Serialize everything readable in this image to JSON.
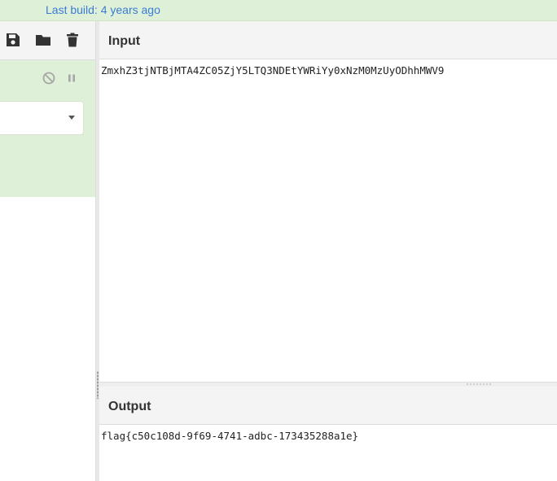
{
  "header": {
    "last_build": "Last build: 4 years ago"
  },
  "toolbar": {
    "icons": [
      "save-icon",
      "folder-icon",
      "trash-icon"
    ]
  },
  "operation": {
    "controls": [
      "disable-icon",
      "pause-icon"
    ],
    "selected_alphabet": ""
  },
  "input": {
    "title": "Input",
    "value": "ZmxhZ3tjNTBjMTA4ZC05ZjY5LTQ3NDEtYWRiYy0xNzM0MzUyODhhMWV9"
  },
  "output": {
    "title": "Output",
    "value": "flag{c50c108d-9f69-4741-adbc-173435288a1e}"
  },
  "colors": {
    "accent_green": "#dff0d8",
    "link_blue": "#3a7bd5"
  }
}
